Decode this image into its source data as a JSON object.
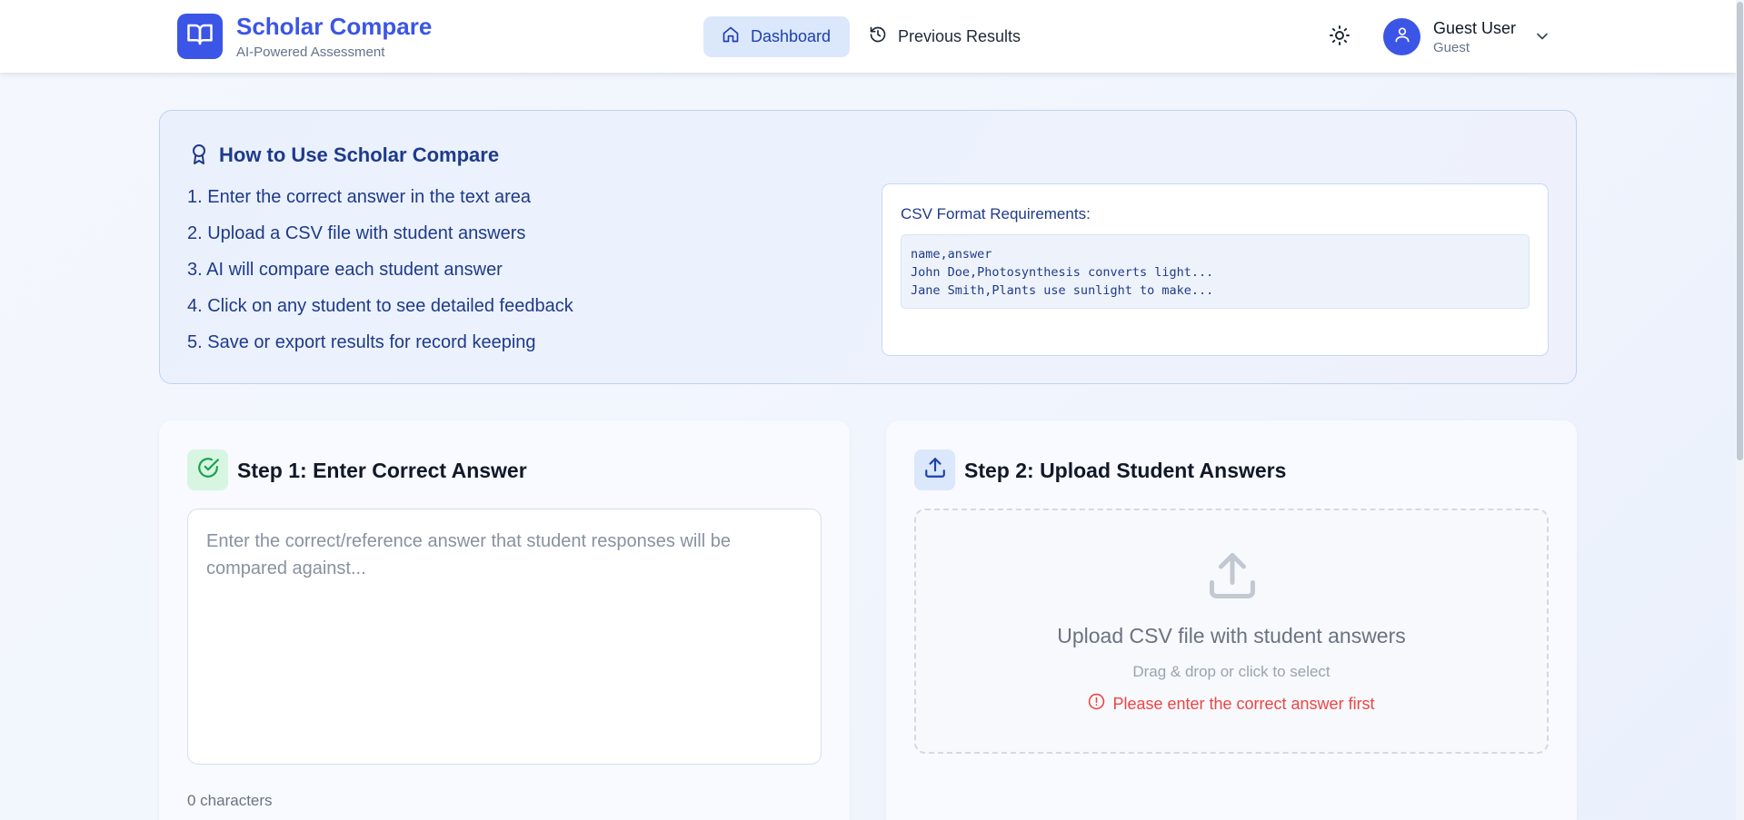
{
  "brand": {
    "title": "Scholar Compare",
    "subtitle": "AI-Powered Assessment"
  },
  "nav": {
    "dashboard": "Dashboard",
    "previous_results": "Previous Results"
  },
  "user": {
    "name": "Guest User",
    "role": "Guest"
  },
  "howto": {
    "title": "How to Use Scholar Compare",
    "steps": [
      "1. Enter the correct answer in the text area",
      "2. Upload a CSV file with student answers",
      "3. AI will compare each student answer",
      "4. Click on any student to see detailed feedback",
      "5. Save or export results for record keeping"
    ],
    "csv": {
      "title": "CSV Format Requirements:",
      "lines": [
        "name,answer",
        "John Doe,Photosynthesis converts light...",
        "Jane Smith,Plants use sunlight to make..."
      ]
    }
  },
  "step1": {
    "title": "Step 1: Enter Correct Answer",
    "value": "",
    "placeholder": "Enter the correct/reference answer that student responses will be compared against...",
    "char_count": "0 characters"
  },
  "step2": {
    "title": "Step 2: Upload Student Answers",
    "dropzone_title": "Upload CSV file with student answers",
    "dropzone_sub": "Drag & drop or click to select",
    "error": "Please enter the correct answer first"
  },
  "icons": {
    "logo": "book-open-icon",
    "dashboard": "home-icon",
    "previous": "history-icon",
    "theme": "sun-icon",
    "avatar": "user-icon",
    "menu": "chevron-down-icon",
    "howto": "award-icon",
    "step1": "check-circle-icon",
    "step2": "upload-icon",
    "error": "alert-circle-icon"
  },
  "colors": {
    "primary": "#3b55e6",
    "accent_text": "#1e3a8a",
    "success_bg": "#d8f5e2",
    "success": "#16a34a",
    "error": "#ef4444"
  }
}
